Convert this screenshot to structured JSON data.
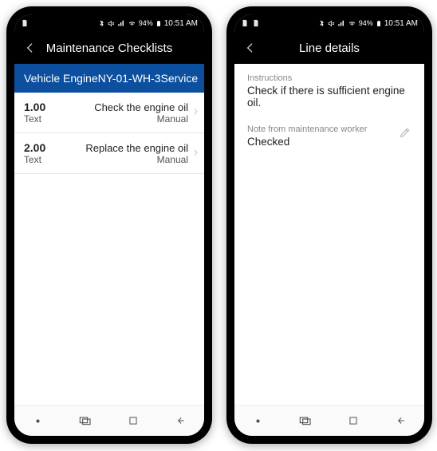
{
  "status": {
    "icons_left_1": "📄",
    "icons_left_2": "📄",
    "bt": "✱",
    "mute": "🔇",
    "signal": "📶",
    "wifi": "📶",
    "battery_text": "94%",
    "battery": "🔋",
    "time": "10:51 AM"
  },
  "phone1": {
    "header_title": "Maintenance Checklists",
    "blue": {
      "left": "Vehicle Engine",
      "mid": "NY-01-WH-3",
      "right": "Service"
    },
    "rows": [
      {
        "num": "1.00",
        "type": "Text",
        "desc": "Check the engine oil",
        "cat": "Manual"
      },
      {
        "num": "2.00",
        "type": "Text",
        "desc": "Replace the engine oil",
        "cat": "Manual"
      }
    ]
  },
  "phone2": {
    "header_title": "Line details",
    "instructions_label": "Instructions",
    "instructions_value": "Check if there is sufficient engine oil.",
    "note_label": "Note from maintenance worker",
    "note_value": "Checked"
  }
}
